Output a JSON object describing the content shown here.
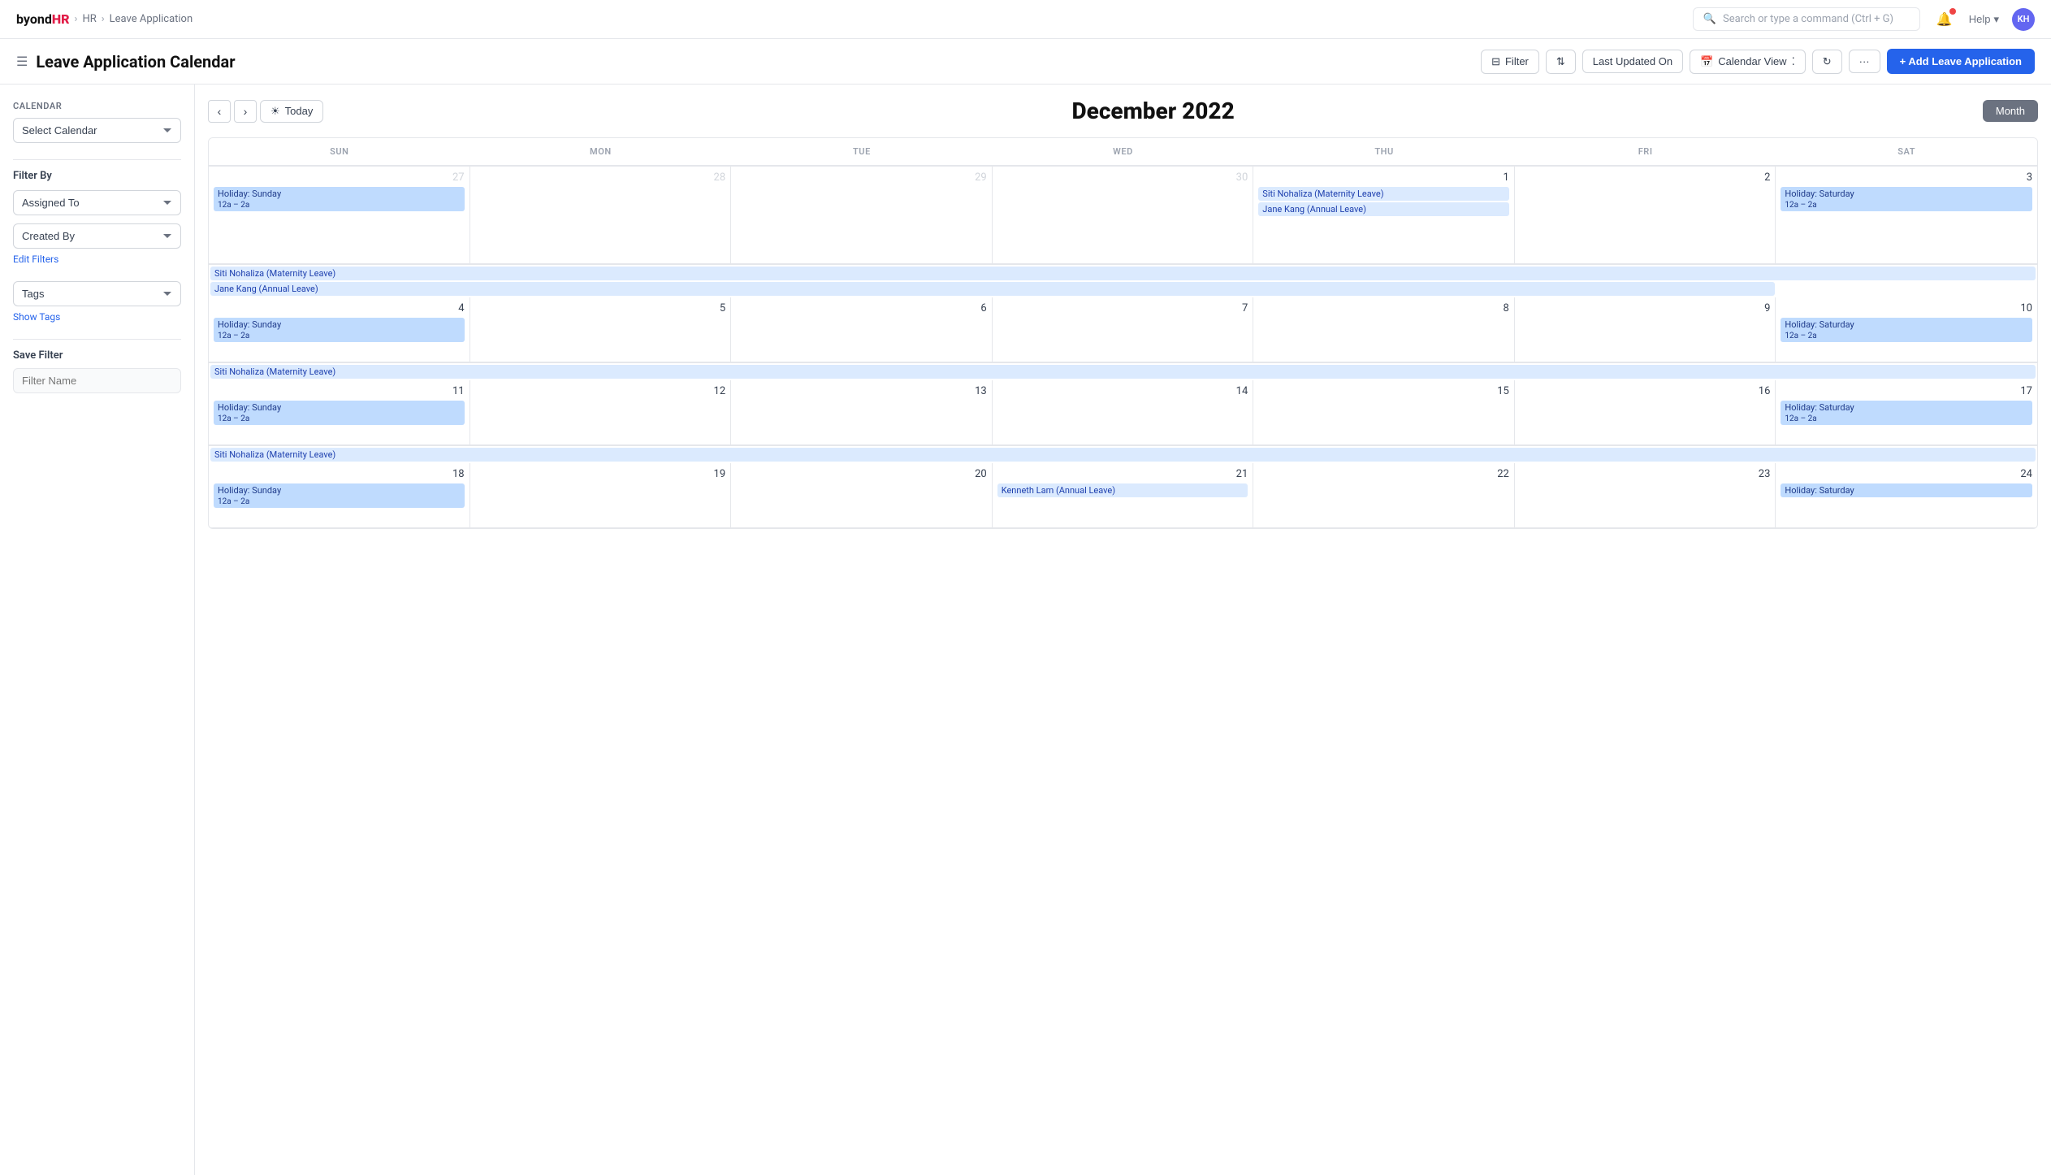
{
  "brand": {
    "name_b": "byond",
    "name_hr": "HR",
    "separator": "›",
    "breadcrumb_1": "HR",
    "breadcrumb_2": "Leave Application"
  },
  "topnav": {
    "search_placeholder": "Search or type a command (Ctrl + G)",
    "help_label": "Help",
    "avatar_initials": "KH"
  },
  "header": {
    "title": "Leave Application Calendar",
    "filter_label": "Filter",
    "sort_label": "Last Updated On",
    "view_label": "Calendar View",
    "add_label": "+ Add Leave Application"
  },
  "sidebar": {
    "calendar_section_label": "Calendar",
    "select_calendar_placeholder": "Select Calendar",
    "filter_by_label": "Filter By",
    "assigned_to_placeholder": "Assigned To",
    "created_by_placeholder": "Created By",
    "edit_filters_label": "Edit Filters",
    "tags_label": "Tags",
    "tags_placeholder": "Tags",
    "show_tags_label": "Show Tags",
    "save_filter_label": "Save Filter",
    "filter_name_placeholder": "Filter Name"
  },
  "calendar": {
    "month_year": "December 2022",
    "today_label": "Today",
    "month_btn": "Month",
    "days": [
      "SUN",
      "MON",
      "TUE",
      "WED",
      "THU",
      "FRI",
      "SAT"
    ],
    "weeks": [
      {
        "dates": [
          27,
          28,
          29,
          30,
          1,
          2,
          3
        ],
        "other_month": [
          true,
          true,
          true,
          true,
          false,
          false,
          false
        ],
        "events": {
          "sun": [
            {
              "text": "Holiday: Sunday",
              "sub": "12a – 2a",
              "style": "event-blue-dark"
            }
          ],
          "thu": [
            {
              "text": "Siti Nohaliza (Maternity Leave)",
              "style": "event-blue"
            },
            {
              "text": "Jane Kang (Annual Leave)",
              "style": "event-blue"
            }
          ],
          "sat": [
            {
              "text": "Holiday: Saturday",
              "sub": "12a – 2a",
              "style": "event-blue-dark"
            }
          ]
        }
      },
      {
        "dates": [
          4,
          5,
          6,
          7,
          8,
          9,
          10
        ],
        "other_month": [
          false,
          false,
          false,
          false,
          false,
          false,
          false
        ],
        "events": {
          "sun": [
            {
              "text": "Holiday: Sunday",
              "sub": "12a – 2a",
              "style": "event-blue-dark"
            }
          ],
          "sat": [
            {
              "text": "Holiday: Saturday",
              "sub": "12a – 2a",
              "style": "event-blue-dark"
            }
          ],
          "span_top": [
            {
              "text": "Siti Nohaliza (Maternity Leave)",
              "style": "event-blue",
              "start": 0,
              "span": 7
            },
            {
              "text": "Jane Kang (Annual Leave)",
              "style": "event-blue",
              "start": 0,
              "span": 6
            }
          ]
        }
      },
      {
        "dates": [
          11,
          12,
          13,
          14,
          15,
          16,
          17
        ],
        "other_month": [
          false,
          false,
          false,
          false,
          false,
          false,
          false
        ],
        "events": {
          "sun": [
            {
              "text": "Holiday: Sunday",
              "sub": "12a – 2a",
              "style": "event-blue-dark"
            }
          ],
          "sat": [
            {
              "text": "Holiday: Saturday",
              "sub": "12a – 2a",
              "style": "event-blue-dark"
            }
          ],
          "span_top": [
            {
              "text": "Siti Nohaliza (Maternity Leave)",
              "style": "event-blue",
              "start": 0,
              "span": 7
            }
          ]
        }
      },
      {
        "dates": [
          18,
          19,
          20,
          21,
          22,
          23,
          24
        ],
        "other_month": [
          false,
          false,
          false,
          false,
          false,
          false,
          false
        ],
        "events": {
          "sun": [
            {
              "text": "Holiday: Sunday",
              "sub": "12a – 2a",
              "style": "event-blue-dark"
            }
          ],
          "wed": [
            {
              "text": "Kenneth Lam (Annual Leave)",
              "style": "event-blue",
              "start": 3,
              "span": 4
            }
          ],
          "sat": [
            {
              "text": "Holiday: Saturday",
              "style": "event-blue-dark"
            }
          ],
          "span_top": [
            {
              "text": "Siti Nohaliza (Maternity Leave)",
              "style": "event-blue",
              "start": 0,
              "span": 7
            }
          ]
        }
      }
    ]
  }
}
